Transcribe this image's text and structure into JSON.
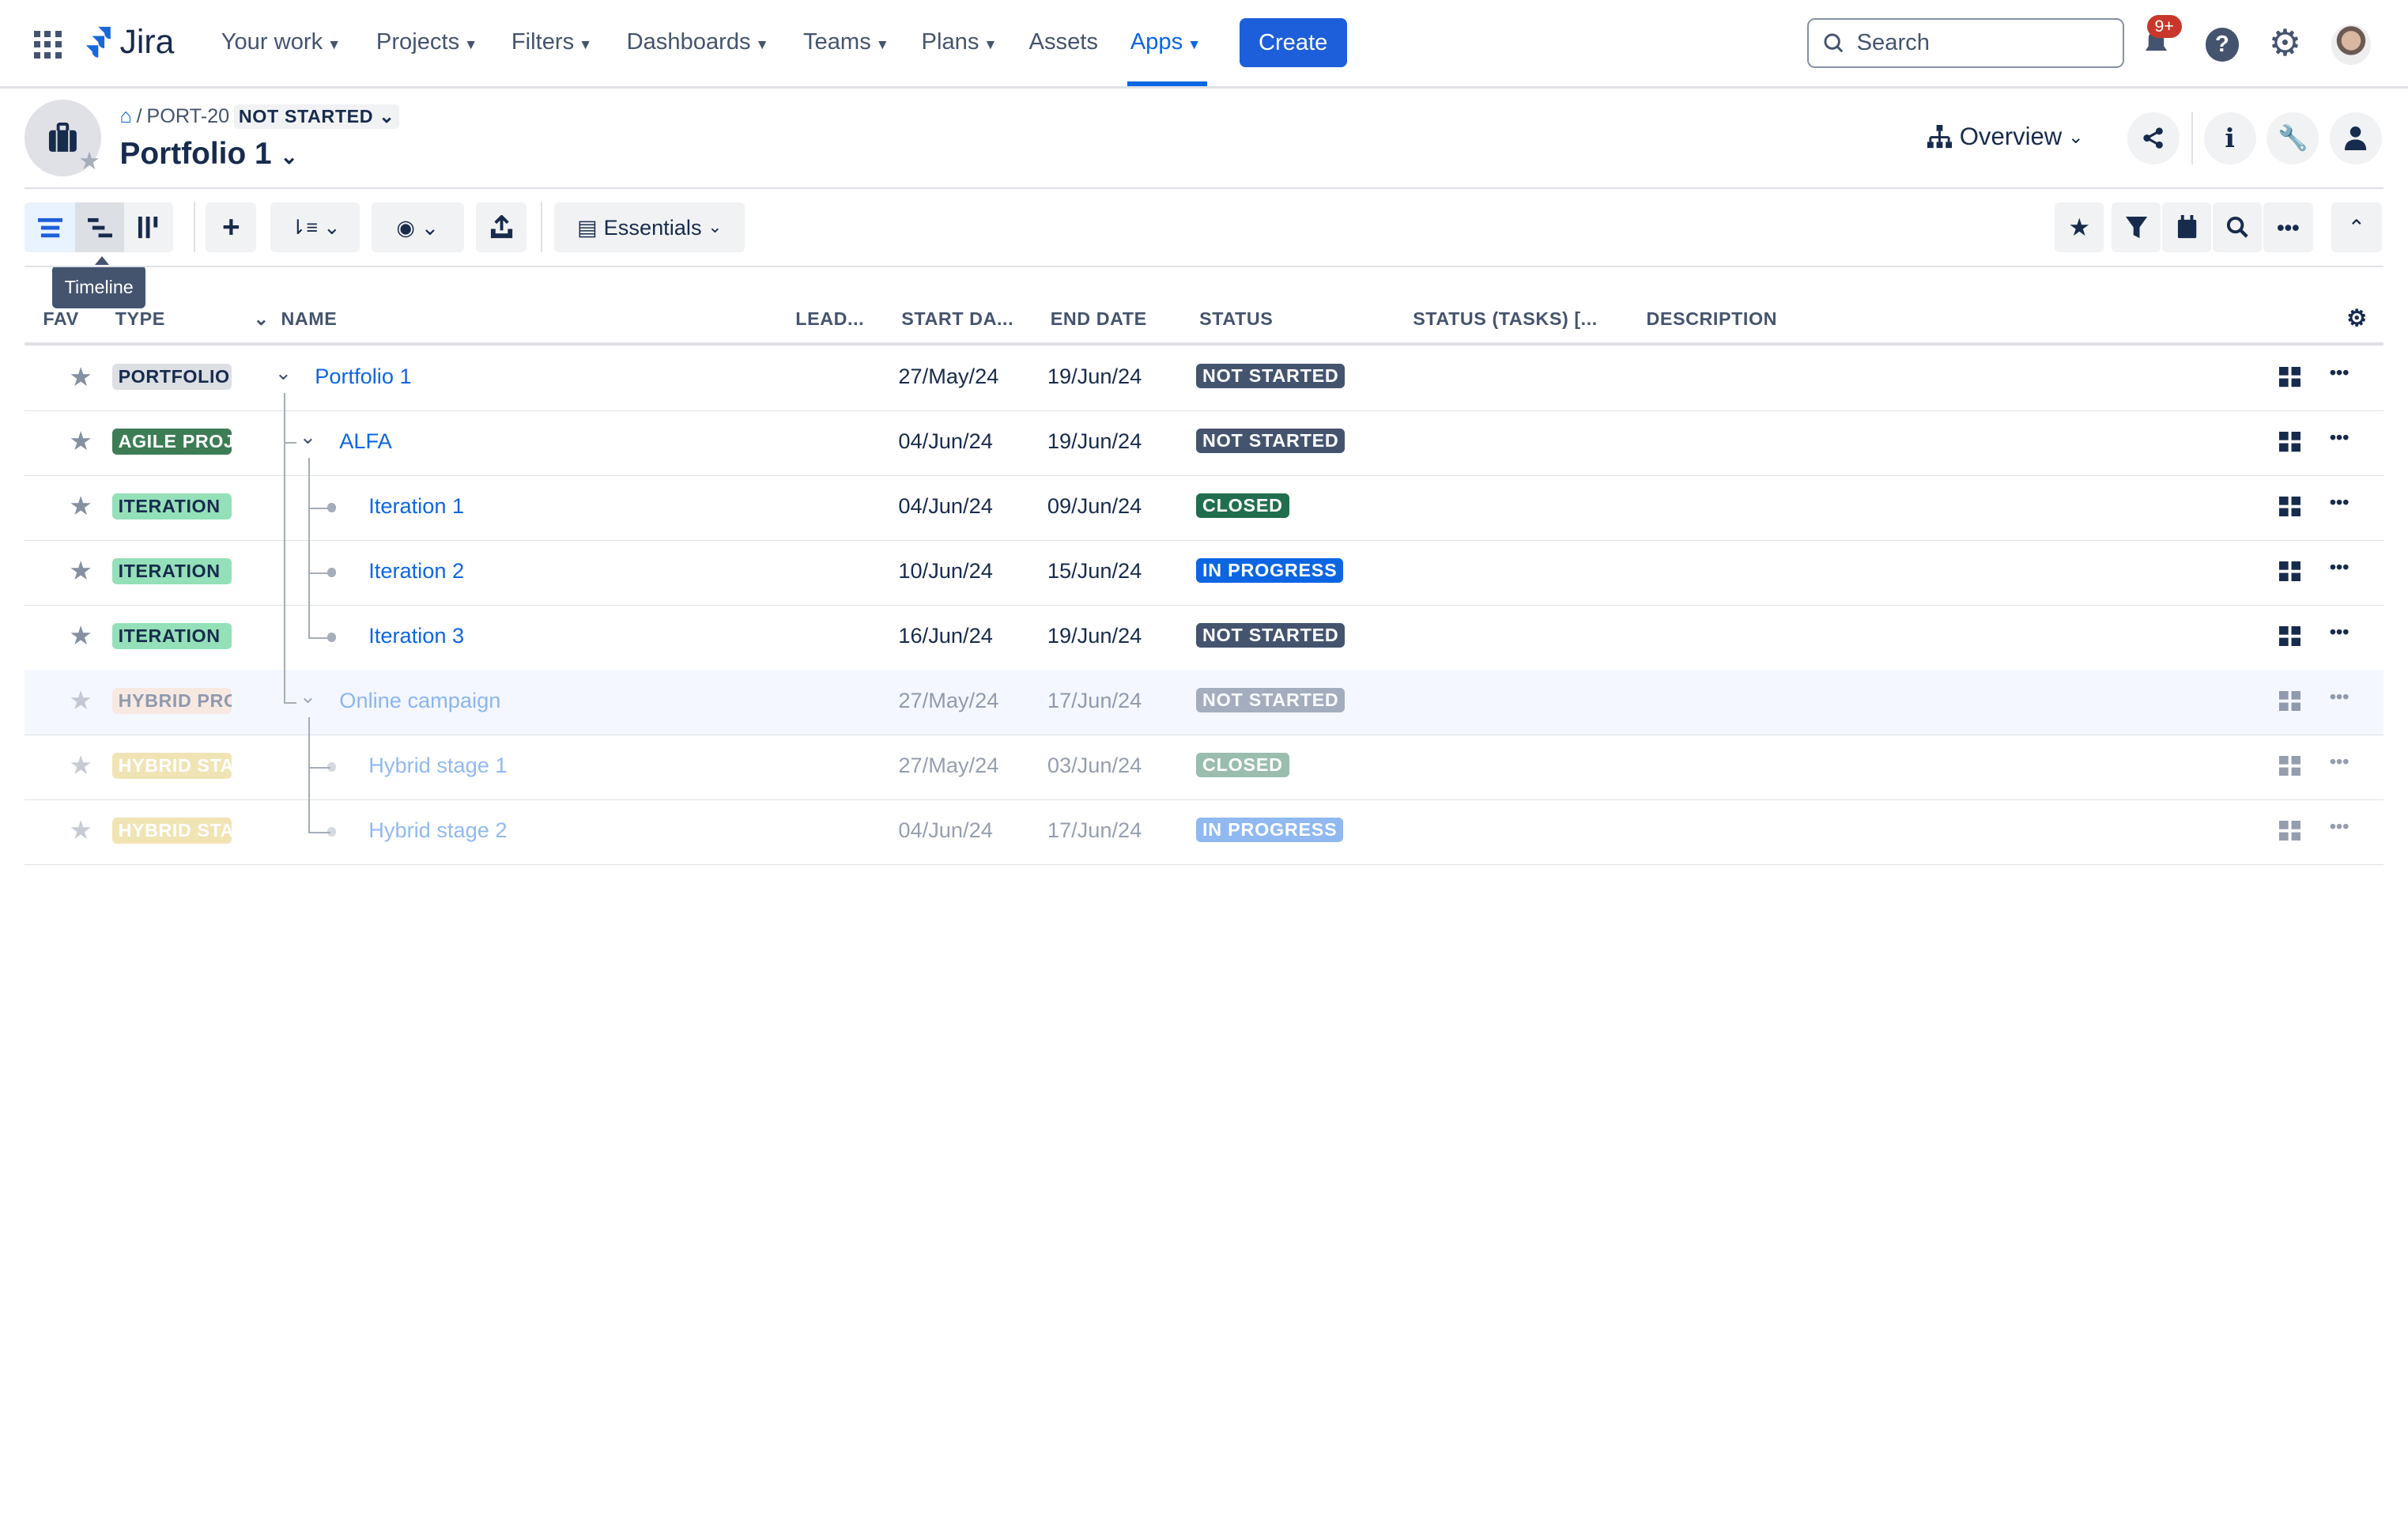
{
  "topnav": {
    "logo": "Jira",
    "items": [
      {
        "label": "Your work",
        "dropdown": true
      },
      {
        "label": "Projects",
        "dropdown": true
      },
      {
        "label": "Filters",
        "dropdown": true
      },
      {
        "label": "Dashboards",
        "dropdown": true
      },
      {
        "label": "Teams",
        "dropdown": true
      },
      {
        "label": "Plans",
        "dropdown": true
      },
      {
        "label": "Assets",
        "dropdown": false
      },
      {
        "label": "Apps",
        "dropdown": true,
        "active": true
      }
    ],
    "create_label": "Create",
    "search_placeholder": "Search",
    "notification_badge": "9+"
  },
  "header": {
    "breadcrumb_key": "PORT-20",
    "status": "NOT STARTED",
    "title": "Portfolio 1",
    "view_label": "Overview"
  },
  "toolbar": {
    "essentials_label": "Essentials",
    "tooltip": "Timeline"
  },
  "table": {
    "columns": [
      "FAV",
      "TYPE",
      "NAME",
      "LEAD...",
      "START DA...",
      "END DATE",
      "STATUS",
      "STATUS (TASKS) [...",
      "DESCRIPTION"
    ],
    "rows": [
      {
        "type": "PORTFOLIO",
        "name": "Portfolio 1",
        "start": "27/May/24",
        "end": "19/Jun/24",
        "status": "NOT STARTED"
      },
      {
        "type": "AGILE PROJ",
        "name": "ALFA",
        "start": "04/Jun/24",
        "end": "19/Jun/24",
        "status": "NOT STARTED"
      },
      {
        "type": "ITERATION",
        "name": "Iteration 1",
        "start": "04/Jun/24",
        "end": "09/Jun/24",
        "status": "CLOSED"
      },
      {
        "type": "ITERATION",
        "name": "Iteration 2",
        "start": "10/Jun/24",
        "end": "15/Jun/24",
        "status": "IN PROGRESS"
      },
      {
        "type": "ITERATION",
        "name": "Iteration 3",
        "start": "16/Jun/24",
        "end": "19/Jun/24",
        "status": "NOT STARTED"
      },
      {
        "type": "HYBRID PRC",
        "name": "Online campaign",
        "start": "27/May/24",
        "end": "17/Jun/24",
        "status": "NOT STARTED"
      },
      {
        "type": "HYBRID STA",
        "name": "Hybrid stage 1",
        "start": "27/May/24",
        "end": "03/Jun/24",
        "status": "CLOSED"
      },
      {
        "type": "HYBRID STA",
        "name": "Hybrid stage 2",
        "start": "04/Jun/24",
        "end": "17/Jun/24",
        "status": "IN PROGRESS"
      }
    ]
  },
  "colors": {
    "accent": "#0c66e4",
    "not_started": "#44546f",
    "closed": "#216e4e",
    "in_progress": "#0c66e4",
    "portfolio": "#dcdfe4",
    "agile": "#3d7d55",
    "iteration": "#94e0b8",
    "hybrid_project": "#fcd9bf",
    "hybrid_stage": "#e2c55b"
  }
}
